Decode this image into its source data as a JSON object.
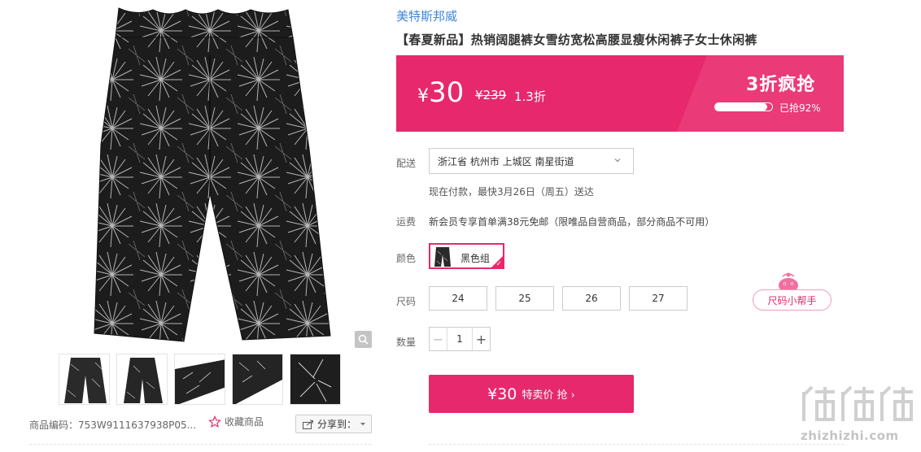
{
  "gallery": {
    "product_code": "商品编码：753W9111637938P05...",
    "favorite_label": "收藏商品",
    "share_label": "分享到：",
    "thumbnails": [
      "front-view",
      "side-view",
      "waist-detail",
      "hem-detail",
      "fabric-detail"
    ]
  },
  "product": {
    "brand": "美特斯邦威",
    "title": "【春夏新品】热销阔腿裤女雪纺宽松高腰显瘦休闲裤子女士休闲裤"
  },
  "price": {
    "yen": "¥",
    "current": "30",
    "original": "¥239",
    "discount": "1.3折",
    "flash_title": "3折疯抢",
    "sold_percent": 92,
    "sold_text": "已抢92%"
  },
  "delivery": {
    "label": "配送",
    "address": "浙江省 杭州市 上城区 南星街道",
    "note": "现在付款，最快3月26日（周五）送达"
  },
  "shipping": {
    "label": "运费",
    "text": "新会员专享首单满38元免邮（限唯品自营商品，部分商品不可用）"
  },
  "color": {
    "label": "颜色",
    "selected": "黑色组"
  },
  "size": {
    "label": "尺码",
    "options": [
      "24",
      "25",
      "26",
      "27"
    ],
    "helper_label": "尺码小帮手"
  },
  "quantity": {
    "label": "数量",
    "value": "1",
    "minus": "−",
    "plus": "+"
  },
  "buy": {
    "price": "¥30",
    "label": "特卖价 抢 ›"
  },
  "watermark": {
    "logo": "值值值",
    "url": "zhizhizhi.com"
  },
  "colors": {
    "accent": "#e7286c",
    "brand_link": "#3e86d8"
  }
}
